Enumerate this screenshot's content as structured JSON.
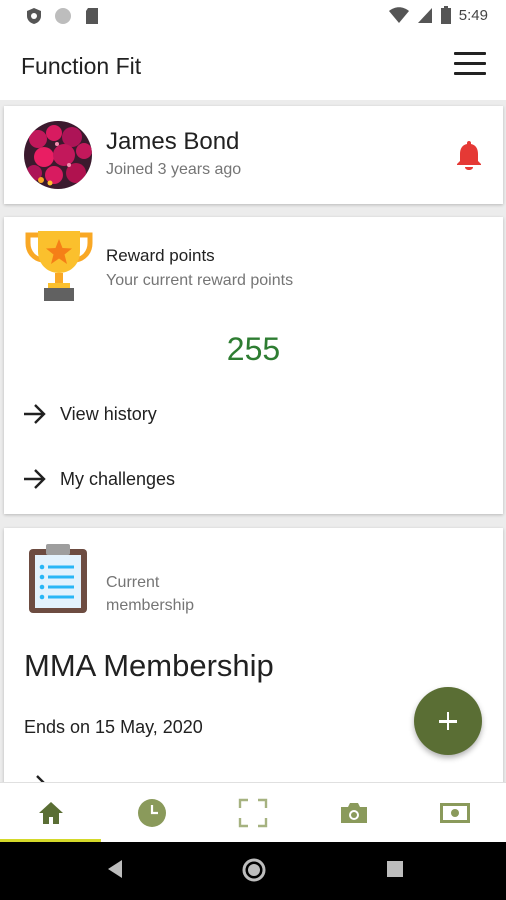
{
  "status_bar": {
    "time": "5:49"
  },
  "app_bar": {
    "title": "Function Fit"
  },
  "profile": {
    "name": "James Bond",
    "joined": "Joined 3 years ago"
  },
  "rewards": {
    "title": "Reward points",
    "subtitle": "Your current reward points",
    "points": "255",
    "view_history_label": "View history",
    "my_challenges_label": "My challenges"
  },
  "membership": {
    "label": "Current membership",
    "name": "MMA Membership",
    "ends": "Ends on 15 May, 2020"
  },
  "bottom_nav": {
    "items": [
      "home-icon",
      "history-icon",
      "scan-icon",
      "camera-icon",
      "money-icon"
    ],
    "active": "home-icon"
  },
  "colors": {
    "accent": "#5a6e34",
    "points": "#2e7d32",
    "bell": "#e53935",
    "nav_indicator": "#d4d92a"
  }
}
